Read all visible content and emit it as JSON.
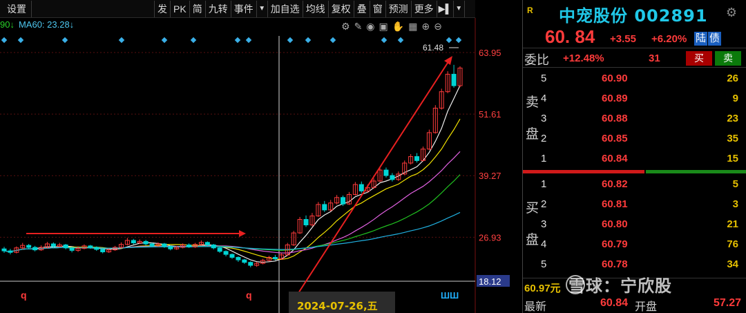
{
  "toolbar": {
    "items": [
      "设置",
      "发",
      "PK",
      "简",
      "九转",
      "事件",
      "加自选",
      "均线",
      "复权",
      "叠",
      "窗",
      "预测",
      "更多"
    ]
  },
  "ma_legend": {
    "ma90": "90↓",
    "ma60": "MA60: 23.28↓"
  },
  "price_axis": {
    "labels": [
      "63.95",
      "51.61",
      "39.27",
      "26.93",
      "18.12"
    ]
  },
  "chart_annotations": {
    "high_label": "61.48",
    "date_label": "2024-07-26,五",
    "marker_left": "q",
    "marker_mid": "q",
    "marker_right": "ШШ"
  },
  "chart_data": {
    "type": "candlestick",
    "y_range": [
      18.12,
      63.95
    ],
    "y_ticks": [
      63.95,
      51.61,
      39.27,
      26.93,
      18.12
    ],
    "candles": [
      [
        24.6,
        24.2,
        25.0,
        23.8
      ],
      [
        24.2,
        23.9,
        24.6,
        23.5
      ],
      [
        23.9,
        24.8,
        25.1,
        23.7
      ],
      [
        24.8,
        25.3,
        25.8,
        24.5
      ],
      [
        25.3,
        24.9,
        25.6,
        24.6
      ],
      [
        24.9,
        24.4,
        25.2,
        24.1
      ],
      [
        24.4,
        24.9,
        25.3,
        24.2
      ],
      [
        24.9,
        25.6,
        26.0,
        24.7
      ],
      [
        25.6,
        25.1,
        25.9,
        24.8
      ],
      [
        25.1,
        25.4,
        25.8,
        24.9
      ],
      [
        25.4,
        24.8,
        25.6,
        24.5
      ],
      [
        24.8,
        24.3,
        25.0,
        23.9
      ],
      [
        24.3,
        24.7,
        25.1,
        24.0
      ],
      [
        24.7,
        25.2,
        25.5,
        24.5
      ],
      [
        25.2,
        24.9,
        25.4,
        24.6
      ],
      [
        24.9,
        24.5,
        25.1,
        24.2
      ],
      [
        24.5,
        24.0,
        24.8,
        23.7
      ],
      [
        24.0,
        24.4,
        24.7,
        23.8
      ],
      [
        24.4,
        24.9,
        25.2,
        24.2
      ],
      [
        24.9,
        25.5,
        25.9,
        24.7
      ],
      [
        25.5,
        26.3,
        26.8,
        25.3
      ],
      [
        26.3,
        25.8,
        26.6,
        25.5
      ],
      [
        25.8,
        26.1,
        26.5,
        25.6
      ],
      [
        26.1,
        25.6,
        26.4,
        25.3
      ],
      [
        25.6,
        25.2,
        25.9,
        24.9
      ],
      [
        25.2,
        25.6,
        25.9,
        25.0
      ],
      [
        25.6,
        25.1,
        25.8,
        24.8
      ],
      [
        25.1,
        24.6,
        25.3,
        24.3
      ],
      [
        24.6,
        24.9,
        25.2,
        24.4
      ],
      [
        24.9,
        25.4,
        25.7,
        24.7
      ],
      [
        25.4,
        25.0,
        25.7,
        24.8
      ],
      [
        25.0,
        25.5,
        25.8,
        24.8
      ],
      [
        25.5,
        25.9,
        26.3,
        25.3
      ],
      [
        25.9,
        25.4,
        26.1,
        25.1
      ],
      [
        25.4,
        24.8,
        25.6,
        24.5
      ],
      [
        24.8,
        24.1,
        25.0,
        23.8
      ],
      [
        24.1,
        23.5,
        24.3,
        23.1
      ],
      [
        23.5,
        22.9,
        23.7,
        22.6
      ],
      [
        22.9,
        22.4,
        23.1,
        22.0
      ],
      [
        22.4,
        21.9,
        22.6,
        21.6
      ],
      [
        21.9,
        21.3,
        22.1,
        20.9
      ],
      [
        21.3,
        21.7,
        22.0,
        21.0
      ],
      [
        21.7,
        22.3,
        22.6,
        21.5
      ],
      [
        22.3,
        22.9,
        23.2,
        22.1
      ],
      [
        22.9,
        22.6,
        23.4,
        22.3
      ],
      [
        22.6,
        23.4,
        23.8,
        22.4
      ],
      [
        23.4,
        25.4,
        25.8,
        23.2
      ],
      [
        25.4,
        27.8,
        28.2,
        25.2
      ],
      [
        27.8,
        30.5,
        31.0,
        27.6
      ],
      [
        30.5,
        29.4,
        31.3,
        29.0
      ],
      [
        29.4,
        31.2,
        31.8,
        29.1
      ],
      [
        31.2,
        33.5,
        34.0,
        31.0
      ],
      [
        33.5,
        32.4,
        34.2,
        32.0
      ],
      [
        32.4,
        33.8,
        34.4,
        32.1
      ],
      [
        33.8,
        34.9,
        35.4,
        33.5
      ],
      [
        34.9,
        33.6,
        35.3,
        33.2
      ],
      [
        33.6,
        35.5,
        36.0,
        33.4
      ],
      [
        35.5,
        37.5,
        38.0,
        35.3
      ],
      [
        37.5,
        36.2,
        38.1,
        35.8
      ],
      [
        36.2,
        36.9,
        37.5,
        35.9
      ],
      [
        36.9,
        38.2,
        38.7,
        36.6
      ],
      [
        38.2,
        40.4,
        40.9,
        38.0
      ],
      [
        40.4,
        39.3,
        40.9,
        38.9
      ],
      [
        39.3,
        38.5,
        39.8,
        38.1
      ],
      [
        38.5,
        39.6,
        40.1,
        38.2
      ],
      [
        39.6,
        41.8,
        42.3,
        39.4
      ],
      [
        41.8,
        43.1,
        43.6,
        41.5
      ],
      [
        43.1,
        42.3,
        43.8,
        41.9
      ],
      [
        42.3,
        44.6,
        45.1,
        42.1
      ],
      [
        44.6,
        47.9,
        48.5,
        44.4
      ],
      [
        47.9,
        52.8,
        53.4,
        47.7
      ],
      [
        52.8,
        56.1,
        56.7,
        52.5
      ],
      [
        56.1,
        59.6,
        60.2,
        55.8
      ],
      [
        59.6,
        57.3,
        61.48,
        56.9
      ],
      [
        57.3,
        60.84,
        61.2,
        57.0
      ]
    ]
  },
  "panel": {
    "badge": "R",
    "name": "中宠股份 002891",
    "price": "60. 84",
    "change": "+3.55",
    "change_pct": "+6.20%",
    "tag_lu": "陆",
    "tag_zhai": "债",
    "weibi_label": "委比",
    "weibi_value": "+12.48%",
    "weibi_count": "31",
    "buy_btn": "买",
    "sell_btn": "卖",
    "sell_side_label": "卖盘",
    "buy_side_label": "买盘",
    "asks": [
      {
        "level": "5",
        "price": "60.90",
        "vol": "26"
      },
      {
        "level": "4",
        "price": "60.89",
        "vol": "9"
      },
      {
        "level": "3",
        "price": "60.88",
        "vol": "23"
      },
      {
        "level": "2",
        "price": "60.85",
        "vol": "35"
      },
      {
        "level": "1",
        "price": "60.84",
        "vol": "15"
      }
    ],
    "bids": [
      {
        "level": "1",
        "price": "60.82",
        "vol": "5"
      },
      {
        "level": "2",
        "price": "60.81",
        "vol": "3"
      },
      {
        "level": "3",
        "price": "60.80",
        "vol": "21"
      },
      {
        "level": "4",
        "price": "60.79",
        "vol": "76"
      },
      {
        "level": "5",
        "price": "60.78",
        "vol": "34"
      }
    ],
    "bottom_info": "60.97元",
    "last_label": "最新",
    "last_value": "60.84",
    "open_label": "开盘",
    "open_value": "57.27",
    "watermark": "雪球：宁欣股"
  },
  "colors": {
    "up": "#ff3b3b",
    "down": "#00d4d4",
    "accent_cyan": "#20c8e8",
    "annotation_arrow": "#e82020"
  }
}
